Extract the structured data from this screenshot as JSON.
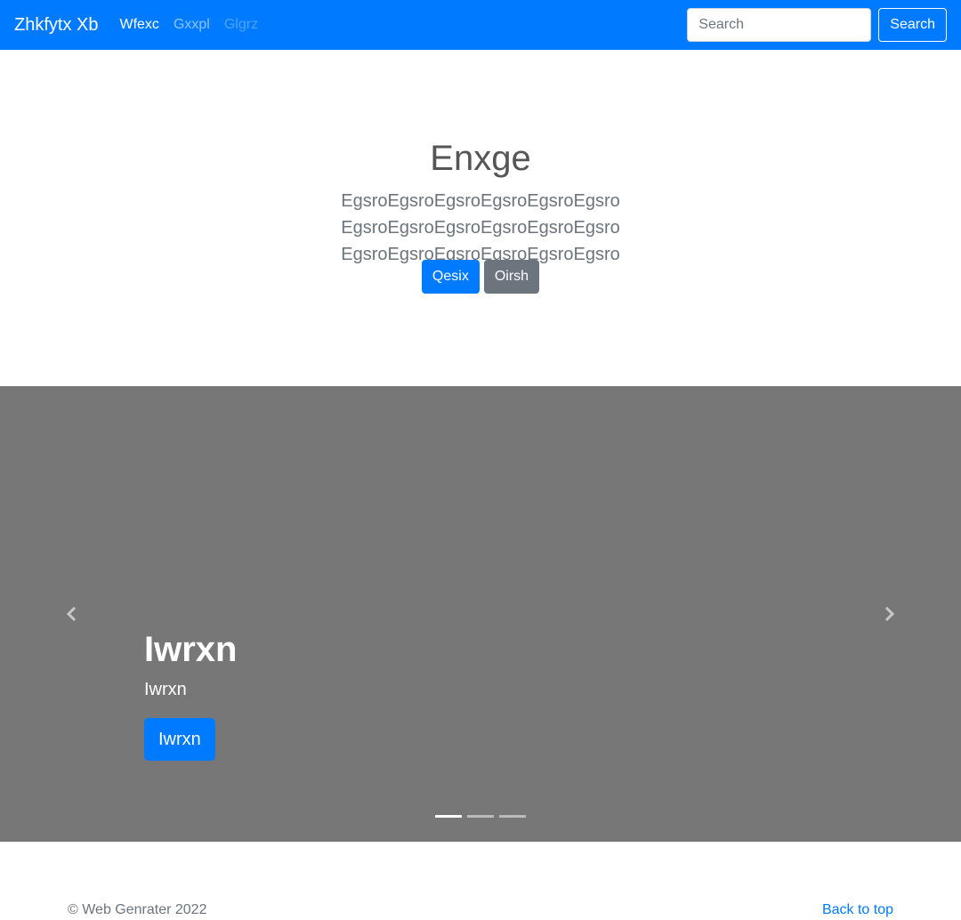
{
  "navbar": {
    "brand": "Zhkfytx Xb",
    "links": [
      {
        "label": "Wfexc",
        "state": "active"
      },
      {
        "label": "Gxxpl",
        "state": "normal"
      },
      {
        "label": "Glgrz",
        "state": "disabled"
      }
    ],
    "search_placeholder": "Search",
    "search_button": "Search"
  },
  "hero": {
    "title": "Enxge",
    "lead": "EgsroEgsroEgsroEgsroEgsroEgsro EgsroEgsroEgsroEgsroEgsroEgsro EgsroEgsroEgsroEgsroEgsroEgsro",
    "primary_button": "Qesix",
    "secondary_button": "Oirsh"
  },
  "carousel": {
    "caption_title": "Iwrxn",
    "caption_text": "Iwrxn",
    "caption_button": "Iwrxn",
    "prev_icon": "chevron-left-icon",
    "next_icon": "chevron-right-icon",
    "slide_count": 3,
    "active_slide": 1
  },
  "footer": {
    "copyright": "© Web Genrater 2022",
    "back_to_top": "Back to top"
  },
  "colors": {
    "primary": "#007bff",
    "secondary": "#6c757d",
    "carousel_bg": "#777777"
  }
}
